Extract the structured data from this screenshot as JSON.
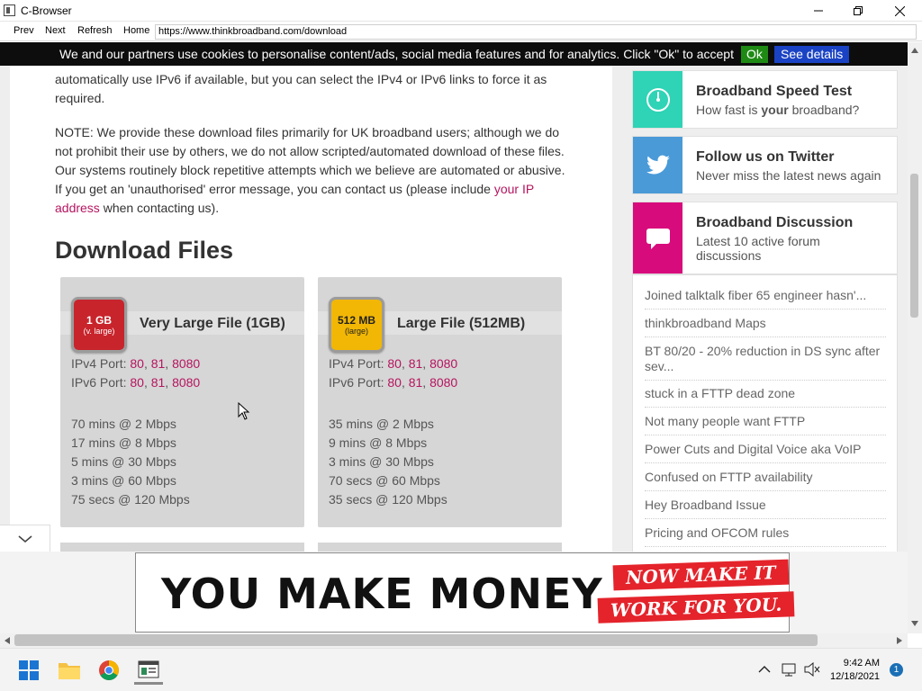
{
  "window": {
    "title": "C-Browser"
  },
  "nav": {
    "prev": "Prev",
    "next": "Next",
    "refresh": "Refresh",
    "home": "Home",
    "url": "https://www.thinkbroadband.com/download"
  },
  "cookie": {
    "text": "We and our partners use cookies to personalise content/ads, social media features and for analytics. Click \"Ok\" to accept",
    "ok": "Ok",
    "details": "See details"
  },
  "content": {
    "ipv6_line1": "automatically use IPv6 if available, but you can select the IPv4 or IPv6 links to force it as",
    "ipv6_line2": "required.",
    "note_line1": "NOTE: We provide these download files primarily for UK broadband users; although we do",
    "note_line2": "not prohibit their use by others, we do not allow scripted/automated download of these files.",
    "note_line3": "Our systems routinely block repetitive attempts which we believe are automated or abusive.",
    "note_line4_pre": "If you get an 'unauthorised' error message, you can contact us (please include ",
    "note_link_a": "your IP",
    "note_link_b": "address",
    "note_line5_post": " when contacting us).",
    "heading": "Download Files"
  },
  "cards": [
    {
      "badge_main": "1 GB",
      "badge_sub": "(v. large)",
      "badge_color": "#c8242c",
      "title": "Very Large File (1GB)",
      "ipv4_label": "IPv4 Port: ",
      "ipv6_label": "IPv6 Port: ",
      "ports": [
        "80",
        "81",
        "8080"
      ],
      "times": [
        "70 mins @ 2 Mbps",
        "17 mins @ 8 Mbps",
        "5 mins @ 30 Mbps",
        "3 mins @ 60 Mbps",
        "75 secs @ 120 Mbps"
      ]
    },
    {
      "badge_main": "512 MB",
      "badge_sub": "(large)",
      "badge_color": "#f2b705",
      "title": "Large File (512MB)",
      "ipv4_label": "IPv4 Port: ",
      "ipv6_label": "IPv6 Port: ",
      "ports": [
        "80",
        "81",
        "8080"
      ],
      "times": [
        "35 mins @ 2 Mbps",
        "9 mins @ 8 Mbps",
        "3 mins @ 30 Mbps",
        "70 secs @ 60 Mbps",
        "35 secs @ 120 Mbps"
      ]
    }
  ],
  "sidebar": {
    "speed": {
      "title": "Broadband Speed Test",
      "sub_pre": "How fast is ",
      "sub_bold": "your",
      "sub_post": " broadband?",
      "color": "#2fd3b5",
      "icon": "speedometer-icon"
    },
    "twitter": {
      "title": "Follow us on Twitter",
      "sub": "Never miss the latest news again",
      "color": "#4a9ad8",
      "icon": "twitter-icon"
    },
    "discussion": {
      "title": "Broadband Discussion",
      "sub": "Latest 10 active forum discussions",
      "color": "#d80b7c",
      "icon": "chat-bubble-icon"
    },
    "forum_items": [
      "Joined talktalk fiber 65 engineer hasn'...",
      "thinkbroadband Maps",
      "BT 80/20 - 20% reduction in DS sync after sev...",
      "stuck in a FTTP dead zone",
      "Not many people want FTTP",
      "Power Cuts and Digital Voice aka VoIP",
      "Confused on FTTP availability",
      "Hey Broadband Issue",
      "Pricing and OFCOM rules"
    ]
  },
  "ad": {
    "main": "YOU MAKE MONEY.",
    "strip1": "NOW MAKE IT",
    "strip2": "WORK FOR YOU."
  },
  "taskbar": {
    "time": "9:42 AM",
    "date": "12/18/2021",
    "badge": "1"
  },
  "colors": {
    "link": "#b5155f",
    "cookie_bg": "#0d0d0d"
  }
}
